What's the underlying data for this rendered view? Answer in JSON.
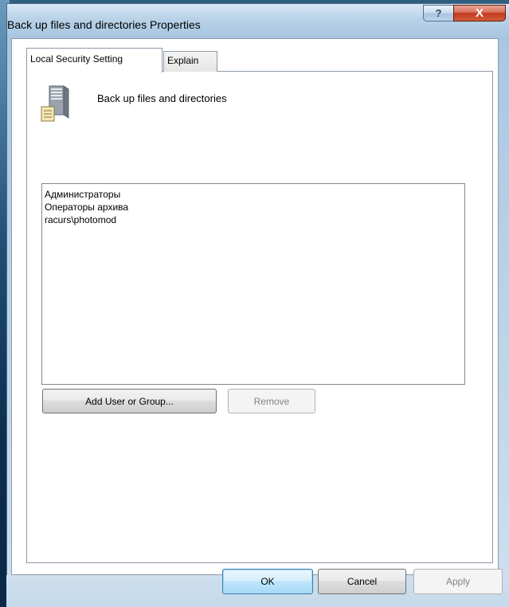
{
  "window": {
    "title": "Back up files and directories Properties",
    "help_glyph": "?",
    "close_glyph": "X"
  },
  "tabs": [
    {
      "label": "Local Security Setting",
      "active": true
    },
    {
      "label": "Explain",
      "active": false
    }
  ],
  "policy": {
    "name": "Back up files and directories",
    "icon": "server-icon"
  },
  "members": [
    "Администраторы",
    "Операторы архива",
    "racurs\\photomod"
  ],
  "buttons": {
    "add": "Add User or Group...",
    "remove": "Remove",
    "ok": "OK",
    "cancel": "Cancel",
    "apply": "Apply"
  },
  "colors": {
    "close_button": "#c2391b",
    "default_button_border": "#3c7fb1",
    "frame_border": "#8e9aa8"
  }
}
